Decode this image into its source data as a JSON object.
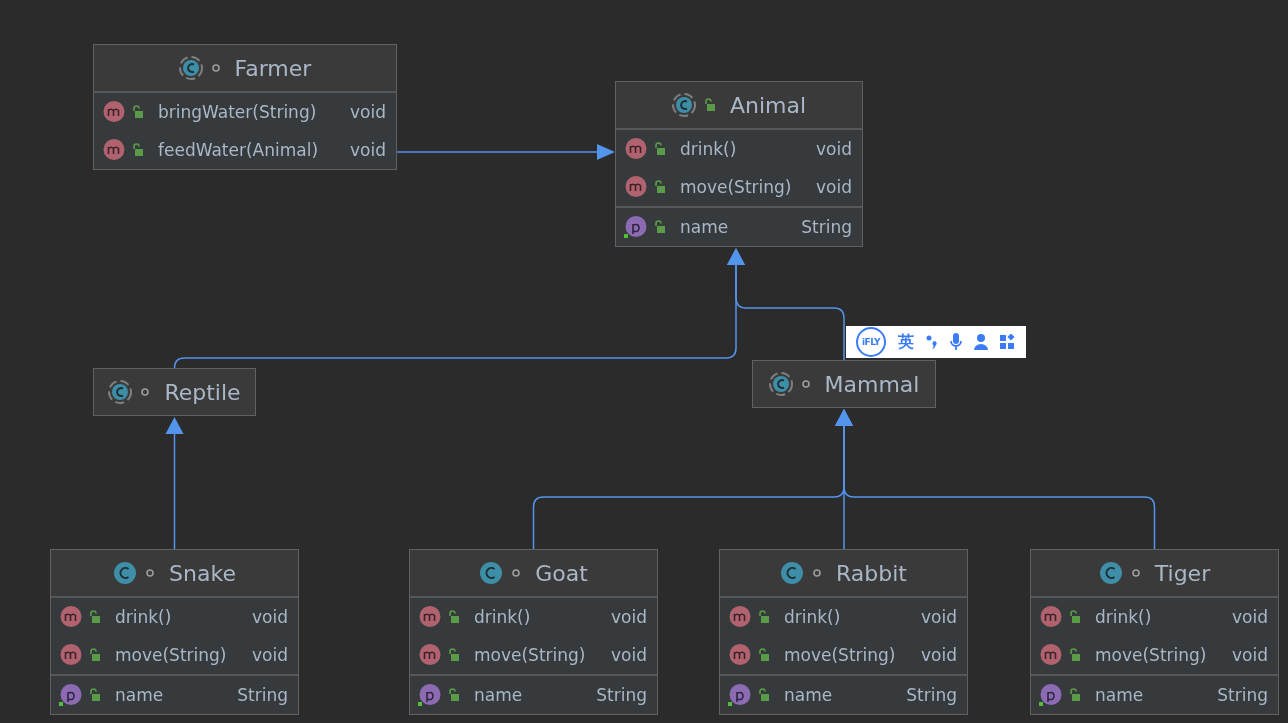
{
  "classes": [
    {
      "name": "Farmer",
      "kind": "abstract",
      "public": false,
      "methods": [
        {
          "name": "bringWater(String)",
          "type": "void"
        },
        {
          "name": "feedWater(Animal)",
          "type": "void"
        }
      ]
    },
    {
      "name": "Animal",
      "kind": "abstract",
      "public": true,
      "methods": [
        {
          "name": "drink()",
          "type": "void"
        },
        {
          "name": "move(String)",
          "type": "void"
        }
      ],
      "fields": [
        {
          "name": "name",
          "type": "String"
        }
      ]
    },
    {
      "name": "Reptile",
      "kind": "abstract",
      "public": false
    },
    {
      "name": "Mammal",
      "kind": "abstract",
      "public": false
    },
    {
      "name": "Snake",
      "kind": "class",
      "public": false,
      "methods": [
        {
          "name": "drink()",
          "type": "void"
        },
        {
          "name": "move(String)",
          "type": "void"
        }
      ],
      "fields": [
        {
          "name": "name",
          "type": "String"
        }
      ]
    },
    {
      "name": "Goat",
      "kind": "class",
      "public": false,
      "methods": [
        {
          "name": "drink()",
          "type": "void"
        },
        {
          "name": "move(String)",
          "type": "void"
        }
      ],
      "fields": [
        {
          "name": "name",
          "type": "String"
        }
      ]
    },
    {
      "name": "Rabbit",
      "kind": "class",
      "public": false,
      "methods": [
        {
          "name": "drink()",
          "type": "void"
        },
        {
          "name": "move(String)",
          "type": "void"
        }
      ],
      "fields": [
        {
          "name": "name",
          "type": "String"
        }
      ]
    },
    {
      "name": "Tiger",
      "kind": "class",
      "public": false,
      "methods": [
        {
          "name": "drink()",
          "type": "void"
        },
        {
          "name": "move(String)",
          "type": "void"
        }
      ],
      "fields": [
        {
          "name": "name",
          "type": "String"
        }
      ]
    }
  ],
  "ime_toolbar": {
    "logo": "iFLY",
    "mode": "英"
  }
}
